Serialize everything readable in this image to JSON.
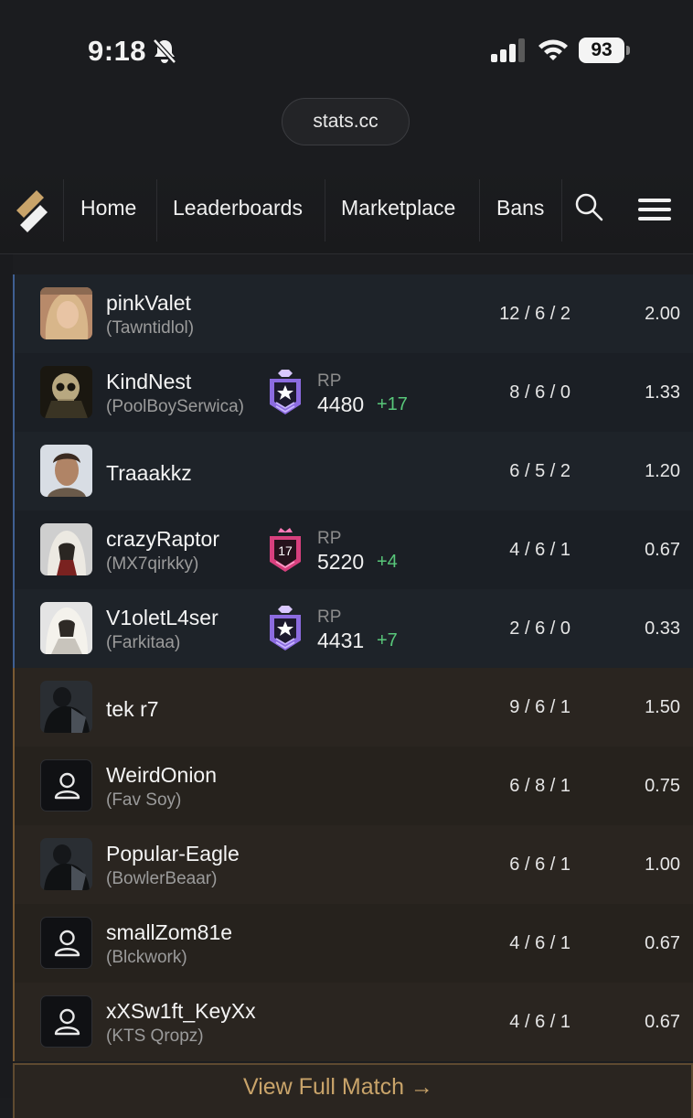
{
  "status_bar": {
    "time": "9:18",
    "battery": "93"
  },
  "browser": {
    "url": "stats.cc"
  },
  "nav": {
    "items": [
      "Home",
      "Leaderboards",
      "Marketplace",
      "Bans"
    ]
  },
  "players": [
    {
      "name": "pinkValet",
      "alias": "(Tawntidlol)",
      "team": "blue",
      "rp": null,
      "rp_label": "",
      "rp_delta": "",
      "kda": "12 / 6 / 2",
      "kd": "2.00",
      "avatar": "portrait-blonde"
    },
    {
      "name": "KindNest",
      "alias": "(PoolBoySerwica)",
      "team": "blue",
      "rank_icon": "diamond-rank-icon",
      "rp_label": "RP",
      "rp": "4480",
      "rp_delta": "+17",
      "kda": "8 / 6 / 0",
      "kd": "1.33",
      "avatar": "skull"
    },
    {
      "name": "Traaakkz",
      "alias": "",
      "team": "blue",
      "rp": null,
      "rp_label": "",
      "rp_delta": "",
      "kda": "6 / 5 / 2",
      "kd": "1.20",
      "avatar": "portrait-man"
    },
    {
      "name": "crazyRaptor",
      "alias": "(MX7qirkky)",
      "team": "blue",
      "rank_icon": "champion-rank-icon",
      "rank_number": "17",
      "rp_label": "RP",
      "rp": "5220",
      "rp_delta": "+4",
      "kda": "4 / 6 / 1",
      "kd": "0.67",
      "avatar": "assassin-hood"
    },
    {
      "name": "V1oletL4ser",
      "alias": "(Farkitaa)",
      "team": "blue",
      "rank_icon": "diamond-rank-icon",
      "rp_label": "RP",
      "rp": "4431",
      "rp_delta": "+7",
      "kda": "2 / 6 / 0",
      "kd": "0.33",
      "avatar": "assassin-white"
    },
    {
      "name": "tek r7",
      "alias": "",
      "team": "orange",
      "rp": null,
      "rp_label": "",
      "rp_delta": "",
      "kda": "9 / 6 / 1",
      "kd": "1.50",
      "avatar": "operator"
    },
    {
      "name": "WeirdOnion",
      "alias": "(Fav Soy)",
      "team": "orange",
      "rp": null,
      "rp_label": "",
      "rp_delta": "",
      "kda": "6 / 8 / 1",
      "kd": "0.75",
      "avatar": "default-user"
    },
    {
      "name": "Popular-Eagle",
      "alias": "(BowlerBeaar)",
      "team": "orange",
      "rp": null,
      "rp_label": "",
      "rp_delta": "",
      "kda": "6 / 6 / 1",
      "kd": "1.00",
      "avatar": "operator"
    },
    {
      "name": "smallZom81e",
      "alias": "(Blckwork)",
      "team": "orange",
      "rp": null,
      "rp_label": "",
      "rp_delta": "",
      "kda": "4 / 6 / 1",
      "kd": "0.67",
      "avatar": "default-user"
    },
    {
      "name": "xXSw1ft_KeyXx",
      "alias": "(KTS Qropz)",
      "team": "orange",
      "rp": null,
      "rp_label": "",
      "rp_delta": "",
      "kda": "4 / 6 / 1",
      "kd": "0.67",
      "avatar": "default-user"
    }
  ],
  "footer": {
    "view_full_match": "View Full Match →"
  },
  "colors": {
    "team_blue": "#3f5f92",
    "team_orange": "#7a5a33",
    "rp_gain": "#58c77a",
    "accent_gold": "#c9a46a"
  }
}
